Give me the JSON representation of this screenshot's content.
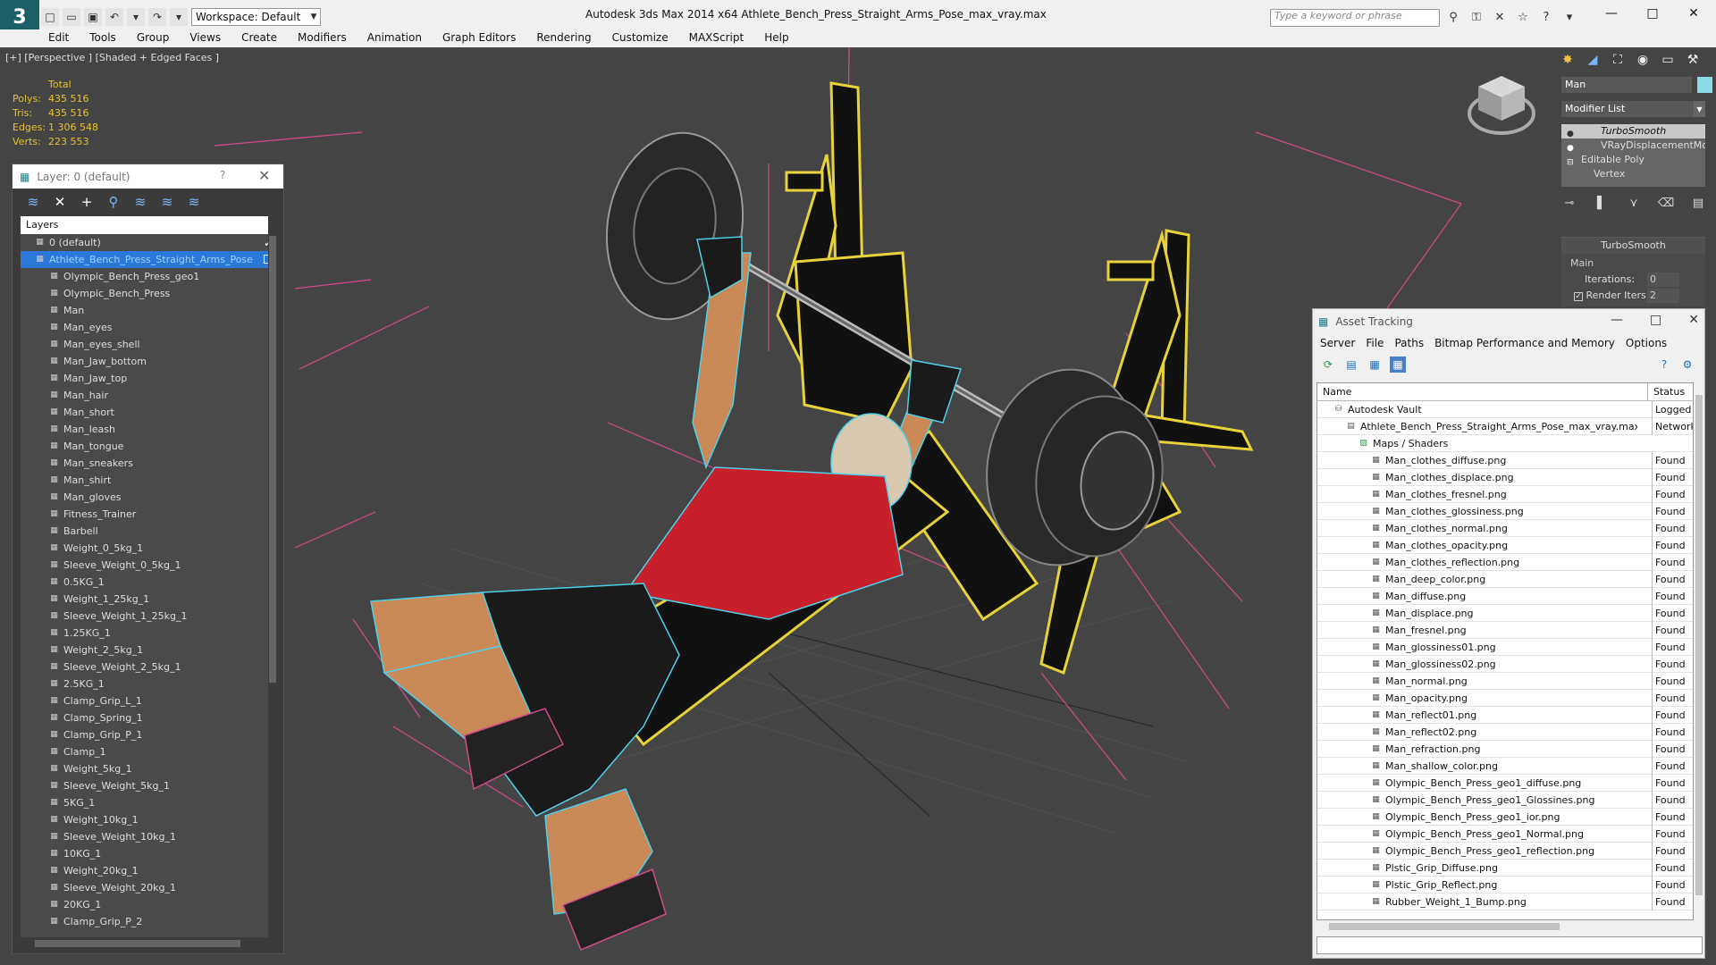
{
  "app": {
    "title": "Autodesk 3ds Max  2014 x64     Athlete_Bench_Press_Straight_Arms_Pose_max_vray.max",
    "logo": "3",
    "workspace": "Workspace: Default",
    "search_placeholder": "Type a keyword or phrase",
    "menu": [
      "Edit",
      "Tools",
      "Group",
      "Views",
      "Create",
      "Modifiers",
      "Animation",
      "Graph Editors",
      "Rendering",
      "Customize",
      "MAXScript",
      "Help"
    ]
  },
  "viewport": {
    "label": "[+] [Perspective ] [Shaded + Edged Faces ]",
    "stats": {
      "header": "Total",
      "rows": [
        {
          "label": "Polys:",
          "value": "435 516"
        },
        {
          "label": "Tris:",
          "value": "435 516"
        },
        {
          "label": "Edges:",
          "value": "1 306 548"
        },
        {
          "label": "Verts:",
          "value": "223 553"
        }
      ]
    }
  },
  "layer_manager": {
    "title": "Layer: 0 (default)",
    "help": "?",
    "column": "Layers",
    "rows": [
      {
        "label": "0 (default)",
        "level": 0,
        "state": "check"
      },
      {
        "label": "Athlete_Bench_Press_Straight_Arms_Pose",
        "level": 0,
        "state": "box",
        "selected": true
      },
      {
        "label": "Olympic_Bench_Press_geo1",
        "level": 1
      },
      {
        "label": "Olympic_Bench_Press",
        "level": 1
      },
      {
        "label": "Man",
        "level": 1
      },
      {
        "label": "Man_eyes",
        "level": 1
      },
      {
        "label": "Man_eyes_shell",
        "level": 1
      },
      {
        "label": "Man_Jaw_bottom",
        "level": 1
      },
      {
        "label": "Man_Jaw_top",
        "level": 1
      },
      {
        "label": "Man_hair",
        "level": 1
      },
      {
        "label": "Man_short",
        "level": 1
      },
      {
        "label": "Man_leash",
        "level": 1
      },
      {
        "label": "Man_tongue",
        "level": 1
      },
      {
        "label": "Man_sneakers",
        "level": 1
      },
      {
        "label": "Man_shirt",
        "level": 1
      },
      {
        "label": "Man_gloves",
        "level": 1
      },
      {
        "label": "Fitness_Trainer",
        "level": 1
      },
      {
        "label": "Barbell",
        "level": 1
      },
      {
        "label": "Weight_0_5kg_1",
        "level": 1
      },
      {
        "label": "Sleeve_Weight_0_5kg_1",
        "level": 1
      },
      {
        "label": "0.5KG_1",
        "level": 1
      },
      {
        "label": "Weight_1_25kg_1",
        "level": 1
      },
      {
        "label": "Sleeve_Weight_1_25kg_1",
        "level": 1
      },
      {
        "label": "1.25KG_1",
        "level": 1
      },
      {
        "label": "Weight_2_5kg_1",
        "level": 1
      },
      {
        "label": "Sleeve_Weight_2_5kg_1",
        "level": 1
      },
      {
        "label": "2.5KG_1",
        "level": 1
      },
      {
        "label": "Clamp_Grip_L_1",
        "level": 1
      },
      {
        "label": "Clamp_Spring_1",
        "level": 1
      },
      {
        "label": "Clamp_Grip_P_1",
        "level": 1
      },
      {
        "label": "Clamp_1",
        "level": 1
      },
      {
        "label": "Weight_5kg_1",
        "level": 1
      },
      {
        "label": "Sleeve_Weight_5kg_1",
        "level": 1
      },
      {
        "label": "5KG_1",
        "level": 1
      },
      {
        "label": "Weight_10kg_1",
        "level": 1
      },
      {
        "label": "Sleeve_Weight_10kg_1",
        "level": 1
      },
      {
        "label": "10KG_1",
        "level": 1
      },
      {
        "label": "Weight_20kg_1",
        "level": 1
      },
      {
        "label": "Sleeve_Weight_20kg_1",
        "level": 1
      },
      {
        "label": "20KG_1",
        "level": 1
      },
      {
        "label": "Clamp_Grip_P_2",
        "level": 1
      }
    ]
  },
  "command_panel": {
    "object_name": "Man",
    "object_color": "#8ad8e8",
    "modifier_list": "Modifier List",
    "stack": [
      {
        "label": "TurboSmooth",
        "kind": "modifier",
        "active": true
      },
      {
        "label": "VRayDisplacementMod",
        "kind": "modifier"
      },
      {
        "label": "Editable Poly",
        "kind": "base"
      },
      {
        "label": "Vertex",
        "kind": "sub"
      }
    ],
    "rollout": {
      "title": "TurboSmooth",
      "group": "Main",
      "iterations_label": "Iterations:",
      "iterations": "0",
      "render_iters_label": "Render Iters:",
      "render_iters": "2",
      "render_iters_checked": true
    }
  },
  "asset_tracking": {
    "title": "Asset Tracking",
    "menu": [
      "Server",
      "File",
      "Paths",
      "Bitmap Performance and Memory",
      "Options"
    ],
    "columns": {
      "name": "Name",
      "status": "Status"
    },
    "rows": [
      {
        "name": "Autodesk Vault",
        "status": "Logged",
        "level": 0,
        "icon": "vault"
      },
      {
        "name": "Athlete_Bench_Press_Straight_Arms_Pose_max_vray.max",
        "status": "Network",
        "level": 1,
        "icon": "file"
      },
      {
        "name": "Maps / Shaders",
        "status": "",
        "level": 2,
        "icon": "folder"
      },
      {
        "name": "Man_clothes_diffuse.png",
        "status": "Found",
        "level": 3,
        "icon": "image"
      },
      {
        "name": "Man_clothes_displace.png",
        "status": "Found",
        "level": 3,
        "icon": "image"
      },
      {
        "name": "Man_clothes_fresnel.png",
        "status": "Found",
        "level": 3,
        "icon": "image"
      },
      {
        "name": "Man_clothes_glossiness.png",
        "status": "Found",
        "level": 3,
        "icon": "image"
      },
      {
        "name": "Man_clothes_normal.png",
        "status": "Found",
        "level": 3,
        "icon": "image"
      },
      {
        "name": "Man_clothes_opacity.png",
        "status": "Found",
        "level": 3,
        "icon": "image"
      },
      {
        "name": "Man_clothes_reflection.png",
        "status": "Found",
        "level": 3,
        "icon": "image"
      },
      {
        "name": "Man_deep_color.png",
        "status": "Found",
        "level": 3,
        "icon": "image"
      },
      {
        "name": "Man_diffuse.png",
        "status": "Found",
        "level": 3,
        "icon": "image"
      },
      {
        "name": "Man_displace.png",
        "status": "Found",
        "level": 3,
        "icon": "image"
      },
      {
        "name": "Man_fresnel.png",
        "status": "Found",
        "level": 3,
        "icon": "image"
      },
      {
        "name": "Man_glossiness01.png",
        "status": "Found",
        "level": 3,
        "icon": "image"
      },
      {
        "name": "Man_glossiness02.png",
        "status": "Found",
        "level": 3,
        "icon": "image"
      },
      {
        "name": "Man_normal.png",
        "status": "Found",
        "level": 3,
        "icon": "image"
      },
      {
        "name": "Man_opacity.png",
        "status": "Found",
        "level": 3,
        "icon": "image"
      },
      {
        "name": "Man_reflect01.png",
        "status": "Found",
        "level": 3,
        "icon": "image"
      },
      {
        "name": "Man_reflect02.png",
        "status": "Found",
        "level": 3,
        "icon": "image"
      },
      {
        "name": "Man_refraction.png",
        "status": "Found",
        "level": 3,
        "icon": "image"
      },
      {
        "name": "Man_shallow_color.png",
        "status": "Found",
        "level": 3,
        "icon": "image"
      },
      {
        "name": "Olympic_Bench_Press_geo1_diffuse.png",
        "status": "Found",
        "level": 3,
        "icon": "image"
      },
      {
        "name": "Olympic_Bench_Press_geo1_Glossines.png",
        "status": "Found",
        "level": 3,
        "icon": "image"
      },
      {
        "name": "Olympic_Bench_Press_geo1_ior.png",
        "status": "Found",
        "level": 3,
        "icon": "image"
      },
      {
        "name": "Olympic_Bench_Press_geo1_Normal.png",
        "status": "Found",
        "level": 3,
        "icon": "image"
      },
      {
        "name": "Olympic_Bench_Press_geo1_reflection.png",
        "status": "Found",
        "level": 3,
        "icon": "image"
      },
      {
        "name": "Plstic_Grip_Diffuse.png",
        "status": "Found",
        "level": 3,
        "icon": "image"
      },
      {
        "name": "Plstic_Grip_Reflect.png",
        "status": "Found",
        "level": 3,
        "icon": "image"
      },
      {
        "name": "Rubber_Weight_1_Bump.png",
        "status": "Found",
        "level": 3,
        "icon": "image"
      }
    ]
  },
  "colors": {
    "stats": "#e8c12c",
    "selection": "#2b78d8",
    "wire_bench": "#e8d23a",
    "wire_body": "#4fd0e8",
    "shirt": "#c8202a",
    "skin": "#c98a58",
    "bbox": "#d04a8a"
  }
}
